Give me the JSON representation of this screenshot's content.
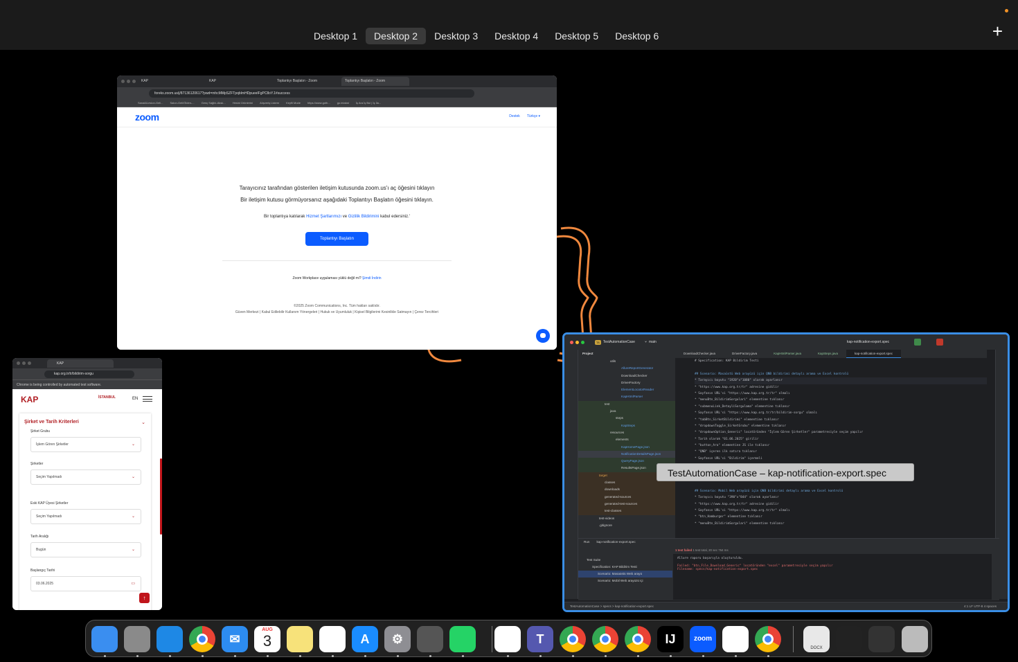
{
  "spaces": [
    "Desktop 1",
    "Desktop 2",
    "Desktop 3",
    "Desktop 4",
    "Desktop 5",
    "Desktop 6"
  ],
  "active_space": "Desktop 2",
  "add_space_label": "+",
  "zoom_window": {
    "tabs": [
      "KAP",
      "KAP",
      "Toplantıyı Başlatın - Zoom",
      "Toplantıyı Başlatın - Zoom"
    ],
    "url": "foreks.zoom.us/j/87136120617?pwd=mhcMMpSZFTpqbImHDpueelFgPC8oY.1#success",
    "bookmarks": [
      "Sanal&Lesion-Geli...",
      "Salon-Geli/Ölden-...",
      "Genç Sağlık-Aksk...",
      "Hesini Ürünlerini",
      "Alışveriş Listem",
      "Keyfli Mode",
      "https://www.goth...",
      "go.intakst",
      "İş Ara İş Bul | İş İla..."
    ],
    "logo": "zoom",
    "nav": [
      "Destek",
      "Türkçe ▾"
    ],
    "line1": "Tarayıcınız tarafından gösterilen iletişim kutusunda zoom.us'ı aç öğesini tıklayın",
    "line2": "Bir iletişim kutusu görmüyorsanız aşağıdaki Toplantıyı Başlatın öğesini tıklayın.",
    "line3_a": "Bir toplantıya katılarak ",
    "line3_link1": "Hizmet Şartlarımızı",
    "line3_b": " ve ",
    "line3_link2": "Gizlilik Bildirimini",
    "line3_c": " kabul edersiniz.'",
    "button": "Toplantıyı Başlatın",
    "line4_a": "Zoom Workplace uygulaması yüklü değil mi? ",
    "line4_link": "Şimdi İndirin",
    "copyright": "©2025 Zoom Communications, Inc. Tüm hakları saklıdır.",
    "footer": "Güven Merkezi | Kabul Edilebilir Kullanım Yönergeleri | Hukuk ve Uyumluluk | Kişisel Bilgilerimi Kesinlikle Satmayın | Çerez Tercihleri"
  },
  "kap_window": {
    "tab": "KAP",
    "url": "kap.org.tr/tr/bildirim-sorgu",
    "info_bar": "Chrome is being controlled by automated test software.",
    "logo": "KAP",
    "city": "İSTANBUL",
    "lang": "EN",
    "card_title": "Şirket ve Tarih Kriterleri",
    "fields": [
      {
        "label": "Şirket Grubu",
        "value": "İşlem Gören Şirketler"
      },
      {
        "label": "Şirketler",
        "value": "Seçim Yapılmadı"
      },
      {
        "label": "Eski KAP Üyesi Şirketler",
        "value": "Seçim Yapılmadı"
      },
      {
        "label": "Tarih Aralığı",
        "value": "Bugün"
      },
      {
        "label": "Başlangıç Tarihi",
        "value": "03.06.2025"
      }
    ]
  },
  "idea_window": {
    "project": "TestAutomationCase",
    "project_badge": "TA",
    "branch": "main",
    "run_config": "kap-notification-export.spec",
    "project_label": "Project",
    "tree": [
      {
        "label": "utils",
        "color": "plain"
      },
      {
        "label": "AllureReportGenerator",
        "color": "blue"
      },
      {
        "label": "DownloadChecker",
        "color": "plain"
      },
      {
        "label": "DriverFactory",
        "color": "plain"
      },
      {
        "label": "ElementLocatorReader",
        "color": "blue"
      },
      {
        "label": "KapHtmlParser",
        "color": "blue"
      },
      {
        "label": "test",
        "color": "plain"
      },
      {
        "label": "java",
        "color": "plain"
      },
      {
        "label": "steps",
        "color": "plain"
      },
      {
        "label": "KapSteps",
        "color": "blue"
      },
      {
        "label": "resources",
        "color": "plain"
      },
      {
        "label": "elements",
        "color": "plain"
      },
      {
        "label": "KapHomePage.json",
        "color": "blue"
      },
      {
        "label": "NotificationDetailsPage.json",
        "color": "blue"
      },
      {
        "label": "QueryPage.json",
        "color": "blue"
      },
      {
        "label": "ResultsPage.json",
        "color": "plain"
      },
      {
        "label": "target",
        "color": "orange"
      },
      {
        "label": "classes",
        "color": "plain"
      },
      {
        "label": "downloads",
        "color": "plain"
      },
      {
        "label": "generated-sources",
        "color": "plain"
      },
      {
        "label": "generated-test-sources",
        "color": "plain"
      },
      {
        "label": "test-classes",
        "color": "plain"
      },
      {
        "label": "test-videos",
        "color": "plain"
      },
      {
        "label": ".gitignore",
        "color": "plain"
      }
    ],
    "editor_tabs": [
      "DownloadChecker.java",
      "DriverFactory.java",
      "KapHtmlParser.java",
      "KapSteps.java",
      "kap-notification-export.spec"
    ],
    "code_lines": [
      "# Specification: KAP Bildirim Testi",
      "",
      "## Scenario: Masaüstü Web arayüzü için QNB bildirimi detaylı arama ve Excel kontrolü",
      "* Tarayıcı boyutu \"1920\"x\"1080\" olarak ayarlanır",
      "* \"https://www.kap.org.tr/tr\" adresine gidilir",
      "* Sayfanın URL'si \"https://www.kap.org.tr/tr\" olmalı",
      "* \"menuBtn_BildirimSorgulari\" elementine tıklanır",
      "* \"submenuLink_DetayliSorgulama\" elementine tıklanır",
      "* Sayfanın URL'si \"https://www.kap.org.tr/tr/bildirim-sorgu\" olmalı",
      "* \"tabBtn_SirketBildirimi\" elementine tıklanır",
      "* \"dropdownToggle_SirketGrubu\" elementine tıklanır",
      "* \"dropdownOption_Generic\" locatöründen \"İşlem Gören Şirketler\" parametresiyle seçim yapılır",
      "* Tarih olarak \"01.06.2025\" girilir",
      "* \"button_Ara\" elementine JS ile tıklanır",
      "* \"QNB\" içeren ilk satıra tıklanır",
      "* Sayfanın URL'si \"Bildirim\" içermeli",
      "",
      "",
      "",
      "",
      "## Scenario: Mobil Web arayüzü için QNB bildirimi detaylı arama ve Excel kontrolü",
      "* Tarayıcı boyutu \"390\"x\"844\" olarak ayarlanır",
      "* \"https://www.kap.org.tr/tr\" adresine gidilir",
      "* Sayfanın URL'si \"https://www.kap.org.tr/tr\" olmalı",
      "* \"btn_Hamburger\" elementine tıklanır",
      "* \"menuBtn_BildirimSorgulari\" elementine tıklanır"
    ],
    "tooltip": "TestAutomationCase – kap-notification-export.spec",
    "run_tab_label": "Run",
    "run_tab": "kap-notification-export.spec",
    "run_status": "1 test failed",
    "run_time": "1 test total, 20 sec 764 ms",
    "run_tree": [
      "Test Suite",
      "Specification: KAP Bildirim Testi",
      "Scenario: Masaüstü Web arayü",
      "Scenario: Mobil Web arayüzü içi"
    ],
    "run_output": [
      "Allure raporu başarıyla oluşturuldu.",
      "",
      "Failed: \"btn_File_Download_Generic\" locatöründen \"excel\" parametresiyle seçim yapılır",
      "Filename: specs/kap-notification-export.spec"
    ],
    "status_path": "TestAutomationCase > specs > kap-notification-export.spec",
    "status_right": "4:1   LF   UTF-8   4 spaces"
  },
  "dock": {
    "apps": [
      {
        "name": "finder-icon",
        "color": "#3a8ef0",
        "glyph": ""
      },
      {
        "name": "launchpad-icon",
        "color": "#8a8a8a",
        "glyph": ""
      },
      {
        "name": "safari-icon",
        "color": "#1e88e5",
        "glyph": ""
      },
      {
        "name": "chrome-icon",
        "color": "#ffffff",
        "glyph": ""
      },
      {
        "name": "mail-icon",
        "color": "#2d8cf0",
        "glyph": "✉"
      },
      {
        "name": "calendar-icon",
        "color": "#ffffff",
        "glyph": "3"
      },
      {
        "name": "notes-icon",
        "color": "#f7e27a",
        "glyph": ""
      },
      {
        "name": "freeform-icon",
        "color": "#ffffff",
        "glyph": ""
      },
      {
        "name": "app-store-icon",
        "color": "#1a8cff",
        "glyph": "A"
      },
      {
        "name": "system-settings-icon",
        "color": "#8e8e93",
        "glyph": "⚙"
      },
      {
        "name": "iphone-mirroring-icon",
        "color": "#555555",
        "glyph": ""
      },
      {
        "name": "whatsapp-icon",
        "color": "#25d366",
        "glyph": ""
      },
      {
        "name": "vscode-icon",
        "color": "#ffffff",
        "glyph": ""
      },
      {
        "name": "teams-icon",
        "color": "#5558af",
        "glyph": "T"
      },
      {
        "name": "chrome-icon",
        "color": "#ffffff",
        "glyph": ""
      },
      {
        "name": "chrome-icon",
        "color": "#ffffff",
        "glyph": ""
      },
      {
        "name": "chrome-icon",
        "color": "#ffffff",
        "glyph": ""
      },
      {
        "name": "intellij-icon",
        "color": "#000000",
        "glyph": "IJ"
      },
      {
        "name": "zoom-icon",
        "color": "#0b5cff",
        "glyph": "zoom"
      },
      {
        "name": "java-icon",
        "color": "#ffffff",
        "glyph": ""
      },
      {
        "name": "chrome-icon",
        "color": "#ffffff",
        "glyph": ""
      }
    ],
    "calendar_month": "AUG",
    "doc_label": "DOCX"
  },
  "colors": {
    "accent": "#3a8ee6",
    "zoom_blue": "#0b5cff",
    "kap_red": "#b01e23",
    "wallpaper_orange": "#f0883e"
  }
}
